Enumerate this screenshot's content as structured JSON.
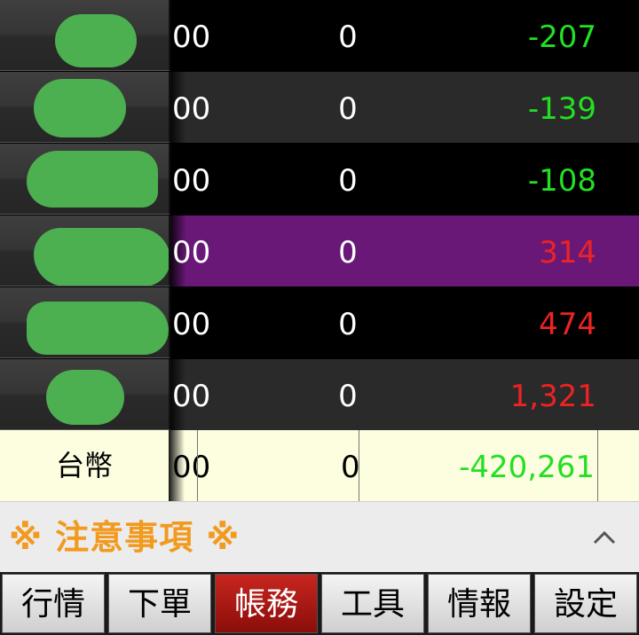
{
  "rows": [
    {
      "col1": "00",
      "col2": "0",
      "col3": "-207",
      "style": "dark",
      "color": "green"
    },
    {
      "col1": "00",
      "col2": "0",
      "col3": "-139",
      "style": "gray",
      "color": "green"
    },
    {
      "col1": "00",
      "col2": "0",
      "col3": "-108",
      "style": "dark",
      "color": "green"
    },
    {
      "col1": "00",
      "col2": "0",
      "col3": "314",
      "style": "purple",
      "color": "red"
    },
    {
      "col1": "00",
      "col2": "0",
      "col3": "474",
      "style": "dark",
      "color": "red"
    },
    {
      "col1": "00",
      "col2": "0",
      "col3": "1,321",
      "style": "gray",
      "color": "red"
    }
  ],
  "total": {
    "label": "台幣",
    "col1": "00",
    "col2": "0",
    "col3": "-420,261"
  },
  "notice": {
    "text": "※ 注意事項 ※",
    "toggle_icon": "chevron-up-icon"
  },
  "tabs": [
    {
      "label": "行情",
      "active": false
    },
    {
      "label": "下單",
      "active": false
    },
    {
      "label": "帳務",
      "active": true
    },
    {
      "label": "工具",
      "active": false
    },
    {
      "label": "情報",
      "active": false
    },
    {
      "label": "設定",
      "active": false
    }
  ],
  "colors": {
    "positive": "#ee2222",
    "negative": "#22e022",
    "highlight_row": "#6a1878",
    "notice_text": "#f29a1e",
    "active_tab": "#c8261f"
  }
}
